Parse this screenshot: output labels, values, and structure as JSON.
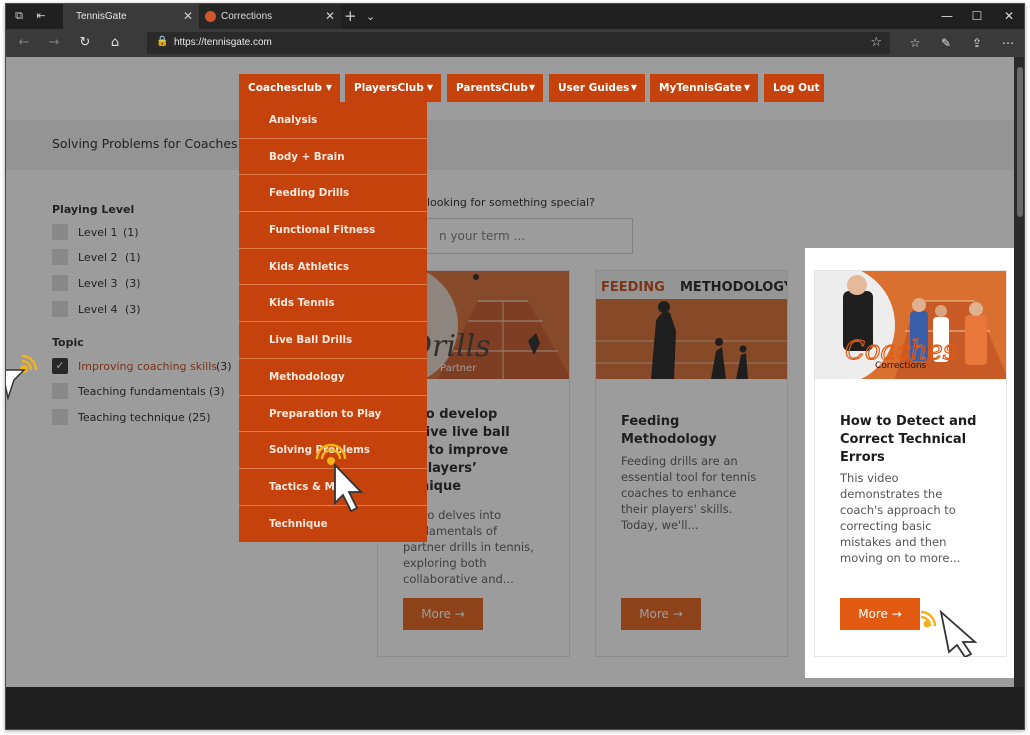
{
  "tabs": [
    {
      "title": "TennisGate",
      "active": true
    },
    {
      "title": "Corrections",
      "active": false
    }
  ],
  "address": {
    "url": "https://tennisgate.com"
  },
  "nav": {
    "items": [
      {
        "label": "Coachesclub",
        "dropdown": true
      },
      {
        "label": "PlayersClub",
        "dropdown": true
      },
      {
        "label": "ParentsClub",
        "dropdown": true
      },
      {
        "label": "User Guides",
        "dropdown": true
      },
      {
        "label": "MyTennisGate",
        "dropdown": true
      },
      {
        "label": "Log Out",
        "dropdown": false
      }
    ],
    "coachesclub_menu": [
      "Analysis",
      "Body + Brain",
      "Feeding Drills",
      "Functional Fitness",
      "Kids Athletics",
      "Kids Tennis",
      "Live Ball Drills",
      "Methodology",
      "Preparation to Play",
      "Solving Problems",
      "Tactics & Me",
      "Technique"
    ]
  },
  "page": {
    "title": "Solving Problems for Coaches"
  },
  "filters": {
    "playing_level": {
      "title": "Playing Level",
      "options": [
        {
          "label": "Level 1",
          "count": "(1)"
        },
        {
          "label": "Level 2",
          "count": "(1)"
        },
        {
          "label": "Level 3",
          "count": "(3)"
        },
        {
          "label": "Level 4",
          "count": "(3)"
        }
      ]
    },
    "topic": {
      "title": "Topic",
      "options": [
        {
          "label": "Improving coaching skills",
          "count": "(3)",
          "checked": true
        },
        {
          "label": "Teaching fundamentals",
          "count": "(3)",
          "checked": false
        },
        {
          "label": "Teaching technique",
          "count": "(25)",
          "checked": false
        }
      ]
    }
  },
  "search": {
    "label": "looking for something special?",
    "placeholder": "n your term ..."
  },
  "cards": [
    {
      "thumb_text": "Drills",
      "thumb_sub": "Partner",
      "title": "w to develop\nective live ball\nills to improve\nir players’\nchnique",
      "desc": "video delves into\nfundamentals of\npartner drills in tennis,\nexploring both\ncollaborative and...",
      "button": "More →"
    },
    {
      "thumb_text_left": "FEEDING",
      "thumb_text_right": "METHODOLOGY",
      "title": "Feeding\nMethodology",
      "desc": "Feeding drills are an\nessential tool for tennis\ncoaches to enhance\ntheir players' skills.\nToday, we'll...",
      "button": "More →"
    },
    {
      "thumb_text": "Coaches",
      "thumb_sub": "Corrections",
      "title": "How to Detect and\nCorrect Technical\nErrors",
      "desc": "This video\ndemonstrates the\ncoach's approach to\ncorrecting basic\nmistakes and then\nmoving on to more...",
      "button": "More →"
    }
  ],
  "colors": {
    "brand": "#c5420d",
    "button": "#e35b12",
    "overlay": "rgba(35,35,35,0.45)"
  }
}
